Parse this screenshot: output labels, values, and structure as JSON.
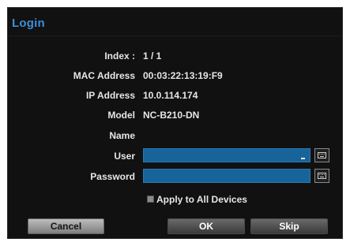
{
  "dialog": {
    "title": "Login"
  },
  "info": {
    "index_label": "Index :",
    "index_value": "1 / 1",
    "mac_label": "MAC Address",
    "mac_value": "00:03:22:13:19:F9",
    "ip_label": "IP Address",
    "ip_value": "10.0.114.174",
    "model_label": "Model",
    "model_value": "NC-B210-DN",
    "name_label": "Name",
    "name_value": ""
  },
  "form": {
    "user_label": "User",
    "user_value": "",
    "password_label": "Password",
    "password_value": "",
    "apply_all_label": "Apply to All Devices",
    "apply_all_checked": false
  },
  "buttons": {
    "cancel": "Cancel",
    "ok": "OK",
    "skip": "Skip"
  },
  "colors": {
    "background": "#111111",
    "title": "#3d8fd6",
    "field": "#17649b",
    "text": "#e6e6e6"
  },
  "icons": {
    "keyboard": "keyboard-icon",
    "checkbox": "checkbox-icon"
  }
}
